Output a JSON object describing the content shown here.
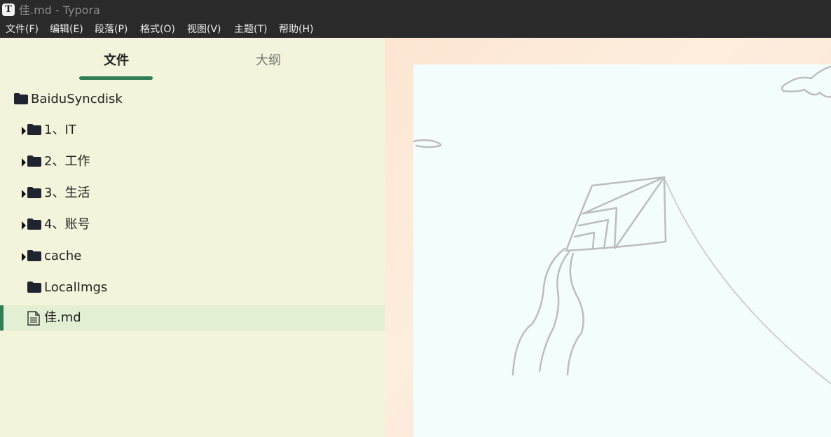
{
  "window": {
    "title": "佳.md - Typora",
    "app_icon_letter": "T"
  },
  "menu": {
    "items": [
      "文件(F)",
      "编辑(E)",
      "段落(P)",
      "格式(O)",
      "视图(V)",
      "主题(T)",
      "帮助(H)"
    ]
  },
  "sidebar": {
    "tabs": [
      {
        "label": "文件",
        "active": true
      },
      {
        "label": "大纲",
        "active": false
      }
    ],
    "tree": [
      {
        "label": "BaiduSyncdisk",
        "type": "folder",
        "expandable": false
      },
      {
        "label": "1、IT",
        "type": "folder",
        "expandable": true
      },
      {
        "label": "2、工作",
        "type": "folder",
        "expandable": true
      },
      {
        "label": "3、生活",
        "type": "folder",
        "expandable": true
      },
      {
        "label": "4、账号",
        "type": "folder",
        "expandable": true
      },
      {
        "label": "cache",
        "type": "folder",
        "expandable": true
      },
      {
        "label": "LocalImgs",
        "type": "folder",
        "expandable": false
      },
      {
        "label": "佳.md",
        "type": "file",
        "selected": true
      }
    ]
  },
  "editor": {
    "background_image": "kite-line-drawing"
  },
  "colors": {
    "titlebar_bg": "#2a2a2b",
    "sidebar_bg": "#f4f4dc",
    "accent": "#2e7d54",
    "selected_row": "#e2efd3",
    "paper_bg": "#f4fdfd"
  }
}
